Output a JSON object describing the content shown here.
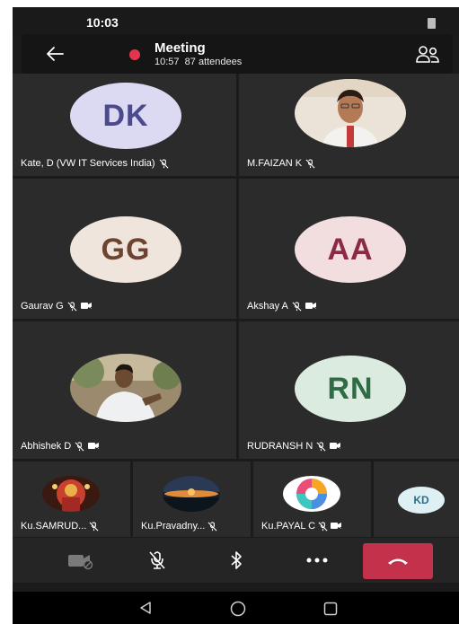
{
  "status_bar": {
    "time": "10:03"
  },
  "header": {
    "title": "Meeting",
    "duration": "10:57",
    "attendees": "87 attendees"
  },
  "participants": [
    {
      "name": "Kate, D (VW IT Services India)",
      "initials": "DK",
      "avatar_bg": "#dcdaf2",
      "initials_color": "#4b4a8c",
      "muted": true,
      "video_off": false
    },
    {
      "name": "M.FAIZAN K",
      "initials": "",
      "avatar_bg": "#e9e0d6",
      "muted": true,
      "video_off": false
    },
    {
      "name": "Gaurav G",
      "initials": "GG",
      "avatar_bg": "#efe5dc",
      "initials_color": "#6e4430",
      "muted": true,
      "video_off": true
    },
    {
      "name": "Akshay A",
      "initials": "AA",
      "avatar_bg": "#f2dede",
      "initials_color": "#8b2a45",
      "muted": true,
      "video_off": true
    },
    {
      "name": "Abhishek D",
      "initials": "",
      "avatar_bg": "#b6a48c",
      "muted": true,
      "video_off": true
    },
    {
      "name": "RUDRANSH N",
      "initials": "RN",
      "avatar_bg": "#dcebdf",
      "initials_color": "#2f6b44",
      "muted": true,
      "video_off": true
    }
  ],
  "strip": [
    {
      "name": "Ku.SAMRUD...",
      "muted": true,
      "video_off": false
    },
    {
      "name": "Ku.Pravadny...",
      "muted": true,
      "video_off": false
    },
    {
      "name": "Ku.PAYAL C",
      "muted": true,
      "video_off": true
    },
    {
      "name": "",
      "initials": "KD"
    }
  ],
  "controls": {
    "camera_icon": "camera-off-icon",
    "mic_icon": "mic-off-icon",
    "bluetooth_icon": "bluetooth-icon",
    "more_icon": "more-icon",
    "hangup_icon": "hang-up-icon",
    "hangup_color": "#c4314b"
  }
}
